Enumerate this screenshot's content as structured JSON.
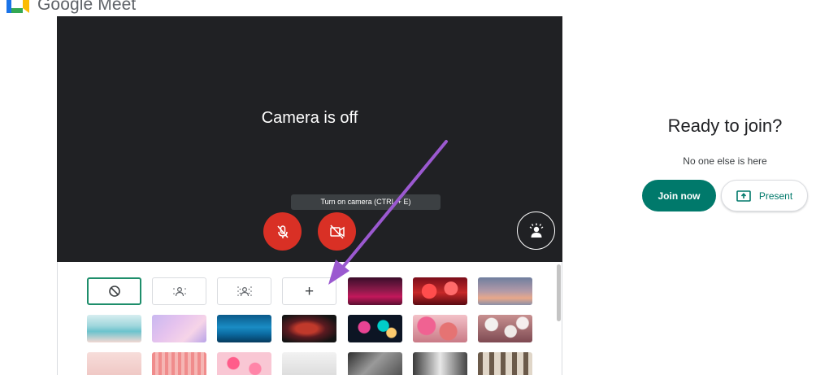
{
  "header": {
    "brand": "Google Meet"
  },
  "preview": {
    "status": "Camera is off",
    "tooltip": "Turn on camera (CTRL + E)"
  },
  "colors": {
    "end_red": "#d93025",
    "accent_green": "#00796b",
    "preview_bg": "#202124",
    "annotation_arrow": "#9b59d0"
  },
  "join": {
    "title": "Ready to join?",
    "subtitle": "No one else is here",
    "join_label": "Join now",
    "present_label": "Present"
  },
  "backgrounds": {
    "options": [
      "no-effect-icon",
      "slight-blur-icon",
      "blur-icon",
      "add-background"
    ],
    "add_label": "+",
    "images": [
      "party-lights",
      "red-lanterns",
      "sunset-sky",
      "beach",
      "pastel-clouds",
      "underwater",
      "nebula",
      "fireworks",
      "pink-blossoms",
      "white-flowers",
      "pink-floral",
      "pink-pattern",
      "petals",
      "white-room",
      "sunlit-room",
      "bright-window",
      "bookshelf"
    ]
  }
}
